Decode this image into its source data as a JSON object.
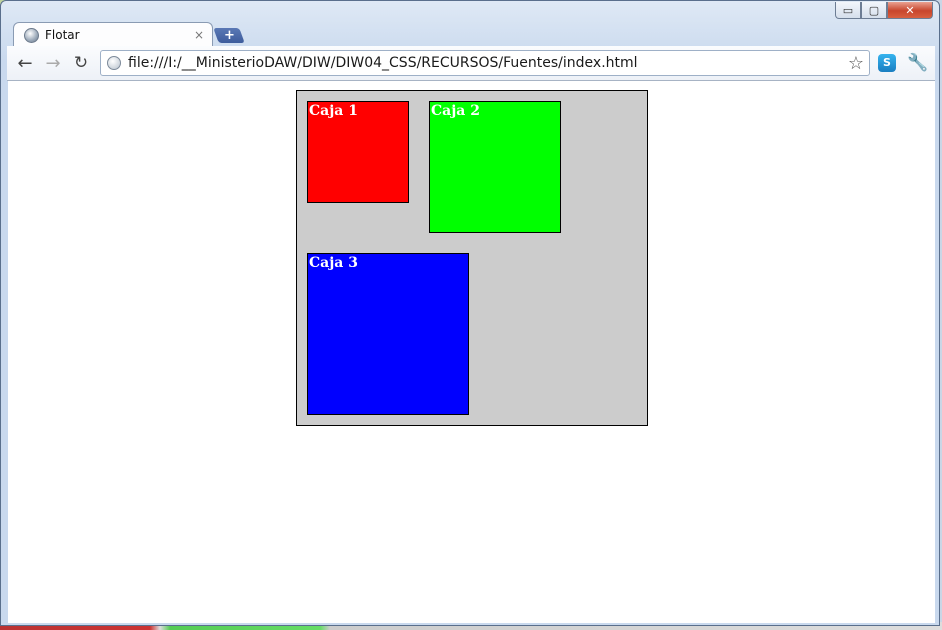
{
  "browser": {
    "tab_title": "Flotar",
    "tab_close": "×",
    "new_tab": "+",
    "url": "file:///I:/__MinisterioDAW/DIW/DIW04_CSS/RECURSOS/Fuentes/index.html",
    "extension": "S",
    "icons": {
      "favicon": "globe-icon",
      "back": "arrow-left-icon",
      "forward": "arrow-right-icon",
      "reload": "reload-icon",
      "bookmark": "star-icon",
      "menu": "wrench-icon"
    }
  },
  "window_controls": {
    "minimize": "▭",
    "maximize": "▢",
    "close": "✕"
  },
  "page": {
    "boxes": [
      {
        "label": "Caja 1",
        "color": "#ff0000"
      },
      {
        "label": "Caja 2",
        "color": "#00ff00"
      },
      {
        "label": "Caja 3",
        "color": "#0000ff"
      }
    ],
    "container_color": "#cccccc"
  }
}
